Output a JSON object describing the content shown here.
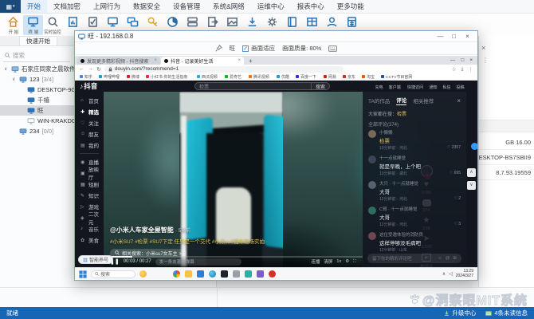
{
  "app": {
    "window_tabs": [
      "开始",
      "文档加密",
      "上网行为",
      "数据安全",
      "设备管理",
      "系统&网络",
      "运维中心",
      "报表中心",
      "更多功能"
    ],
    "active_tab": "开始",
    "ribbon_icons": [
      {
        "name": "home",
        "label": "开 始",
        "type": "home",
        "color": "#d98b3a"
      },
      {
        "name": "terminal",
        "label": "终 端",
        "type": "monitor",
        "color": "#2e75b6",
        "active": true
      },
      {
        "name": "realtime-monitor",
        "label": "实时监控",
        "type": "search",
        "color": "#5b6b7b"
      },
      {
        "name": "report-chart",
        "label": "",
        "type": "chart-doc",
        "color": "#2e75b6"
      },
      {
        "name": "policy-check",
        "label": "",
        "type": "checklist",
        "color": "#5b6b7b"
      },
      {
        "name": "screen-monitor",
        "label": "",
        "type": "monitor",
        "color": "#2e75b6"
      },
      {
        "name": "remote-control",
        "label": "",
        "type": "monitor-multi",
        "color": "#2e75b6"
      },
      {
        "name": "encryption-key",
        "label": "",
        "type": "key",
        "color": "#e0a82e"
      },
      {
        "name": "statistics-pie",
        "label": "",
        "type": "pie",
        "color": "#2e6da4"
      },
      {
        "name": "server-manage",
        "label": "",
        "type": "server",
        "color": "#5b6b7b"
      },
      {
        "name": "file-dispatch",
        "label": "",
        "type": "doc-arrow",
        "color": "#5b6b7b"
      },
      {
        "name": "screen-capture",
        "label": "",
        "type": "image",
        "color": "#5b6b7b"
      },
      {
        "name": "client-download",
        "label": "",
        "type": "download",
        "color": "#2e75b6"
      },
      {
        "name": "settings-gear",
        "label": "",
        "type": "gear",
        "color": "#5b6b7b"
      },
      {
        "name": "manual-book",
        "label": "",
        "type": "book",
        "color": "#2e75b6"
      },
      {
        "name": "roster-grid",
        "label": "",
        "type": "grid-doc",
        "color": "#2e75b6"
      },
      {
        "name": "user-account",
        "label": "",
        "type": "person",
        "color": "#2e75b6"
      },
      {
        "name": "license-calc",
        "label": "",
        "type": "calc",
        "color": "#2e75b6"
      }
    ],
    "status_bar": {
      "left": "就绪",
      "upgrade": "升级中心",
      "messages": "4条未读信息"
    },
    "watermark": "@洞察眼MIT系统"
  },
  "sidebar": {
    "tab_label": "快速开始",
    "search_placeholder": "搜索",
    "tree": [
      {
        "label": "石家庄同家之晨软件开发有限公司",
        "count": "",
        "level": 0,
        "icon": "company",
        "expander": "∨"
      },
      {
        "label": "123",
        "count": "[3/4]",
        "level": 1,
        "icon": "group",
        "expander": "∨"
      },
      {
        "label": "DESKTOP-9G8NAB0",
        "count": "",
        "level": 2,
        "icon": "pc-online",
        "expander": ""
      },
      {
        "label": "千禧",
        "count": "",
        "level": 2,
        "icon": "pc-online",
        "expander": ""
      },
      {
        "label": "旺",
        "count": "",
        "level": 2,
        "icon": "pc-online",
        "expander": "",
        "selected": true
      },
      {
        "label": "WIN-KRAKDOL5913",
        "count": "",
        "level": 2,
        "icon": "pc-offline",
        "expander": ""
      },
      {
        "label": "234",
        "count": "[0/0]",
        "level": 1,
        "icon": "group",
        "expander": ""
      }
    ]
  },
  "details_panel": {
    "rows": [
      "16.00 GB",
      "DESKTOP-BS7SBII9",
      "8.7.93.19559"
    ]
  },
  "viewer": {
    "title": "旺 - 192.168.0.8",
    "controls": [
      "—",
      "□",
      "×"
    ],
    "toolbar": {
      "terminal_name": "旺",
      "fit_label": "画面适应",
      "quality_label": "画面质量: 80%"
    }
  },
  "browser": {
    "tabs": [
      {
        "title": "发现更多精彩视频 - 抖音搜索",
        "active": false
      },
      {
        "title": "抖音 - 记录美好生活",
        "active": true
      }
    ],
    "url": "douyin.com/?recommend=1",
    "bookmarks": [
      "知乎",
      "哔哩哔哩",
      "微博",
      "小红书-你的生活指南",
      "西瓜视频",
      "爱奇艺",
      "腾讯视频",
      "优酷",
      "百度一下",
      "网易",
      "京东",
      "淘宝",
      "CCTV节目官网"
    ]
  },
  "douyin": {
    "logo": "抖音",
    "search_text": "检票",
    "search_button": "搜索",
    "header_links": [
      "充电",
      "客户端",
      "快捷访问",
      "通知",
      "私信",
      "投稿"
    ],
    "nav": [
      {
        "label": "首页",
        "icon": "⌂"
      },
      {
        "label": "精选",
        "icon": "✚",
        "active": true
      },
      {
        "label": "关注",
        "icon": "♡"
      },
      {
        "label": "朋友",
        "icon": "☺"
      },
      {
        "label": "我的",
        "icon": "▤"
      },
      {
        "label": "直播",
        "icon": "◉",
        "section": true
      },
      {
        "label": "放映厅",
        "icon": "▣"
      },
      {
        "label": "短剧",
        "icon": "▦"
      },
      {
        "label": "知识",
        "icon": "✎"
      },
      {
        "label": "游戏",
        "icon": "▷"
      },
      {
        "label": "二次元",
        "icon": "◈"
      },
      {
        "label": "音乐",
        "icon": "♪"
      },
      {
        "label": "美食",
        "icon": "✿"
      }
    ],
    "video": {
      "author": "@小米人车家全屋智能",
      "author_suffix": "· 5天前",
      "tags": "#小米SU7 #检票 #SU7下定 任只是一个交代 #小米su7提车现场实拍",
      "search_pill": "相关搜索：小米su7女车主  >",
      "time": "00:03 / 00:27",
      "danmaku_placeholder": "发一条友善的弹幕",
      "autoplay_label": "连播",
      "clear_label": "清屏"
    },
    "actions": {
      "likes": "5789",
      "comments": "974",
      "favorites": "299",
      "shares": "1725",
      "related_label": "看相关"
    },
    "comments_panel": {
      "tabs": [
        "TA的作品",
        "评论",
        "相关推荐"
      ],
      "active_tab": "评论",
      "hot_label": "大家都在搜：",
      "hot_term": "检票",
      "total": "全部评论(374)",
      "comments": [
        {
          "name": "小懒懒",
          "text": "检票",
          "meta": "10分钟前 · 河北",
          "likes": "2357",
          "highlight": true
        },
        {
          "name": "十一点就睡觉",
          "text": "就是早晚，上个吧",
          "meta": "13分钟前 · 湖北",
          "likes": "695"
        },
        {
          "name": "大只 · 十一点就睡觉",
          "text": "大哥",
          "meta": "12分钟前 · 河北",
          "likes": "2"
        },
        {
          "name": "C哥 · 十一点就睡觉",
          "text": "大哥",
          "meta": "12分钟前 · 河北",
          "likes": "3"
        },
        {
          "name": "这位受邀体验的消防员",
          "text": "这样停够没毛病吧",
          "meta": "12分钟前 · 山东",
          "likes": ""
        }
      ],
      "input_placeholder": "留下你的精彩评论吧"
    }
  },
  "remote_desktop": {
    "taskbar": {
      "search": "搜索",
      "time": "13:29",
      "date": "2024/3/27"
    },
    "plugin_pill": "智能养号"
  }
}
